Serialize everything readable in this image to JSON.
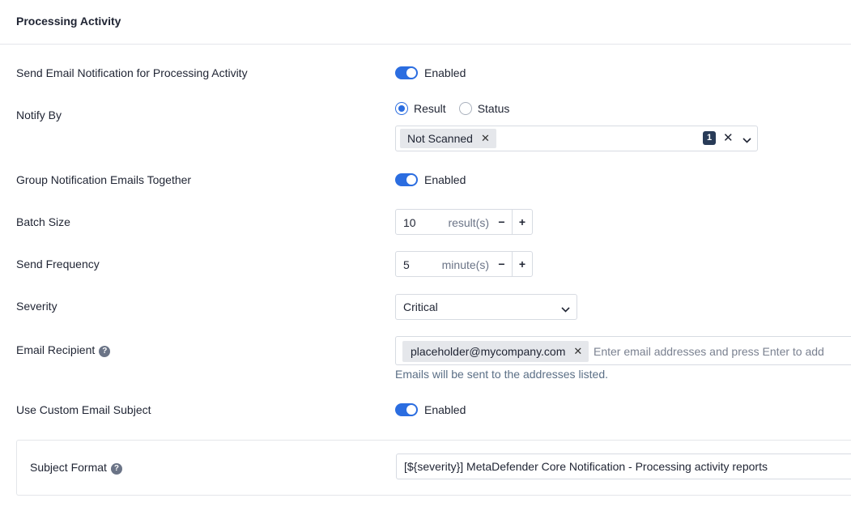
{
  "header": {
    "title": "Processing Activity"
  },
  "send_email": {
    "label": "Send Email Notification for Processing Activity",
    "toggle_label": "Enabled"
  },
  "notify_by": {
    "label": "Notify By",
    "options": [
      {
        "label": "Result",
        "checked": true
      },
      {
        "label": "Status",
        "checked": false
      }
    ],
    "selected_chips": [
      "Not Scanned"
    ],
    "count": "1"
  },
  "group_emails": {
    "label": "Group Notification Emails Together",
    "toggle_label": "Enabled"
  },
  "batch_size": {
    "label": "Batch Size",
    "value": "10",
    "unit": "result(s)",
    "minus": "−",
    "plus": "+"
  },
  "send_frequency": {
    "label": "Send Frequency",
    "value": "5",
    "unit": "minute(s)",
    "minus": "−",
    "plus": "+"
  },
  "severity": {
    "label": "Severity",
    "value": "Critical"
  },
  "email_recipient": {
    "label": "Email Recipient",
    "chips": [
      "placeholder@mycompany.com"
    ],
    "placeholder": "Enter email addresses and press Enter to add",
    "helper": "Emails will be sent to the addresses listed."
  },
  "custom_subject": {
    "label": "Use Custom Email Subject",
    "toggle_label": "Enabled"
  },
  "subject_format": {
    "label": "Subject Format",
    "value": "[${severity}] MetaDefender Core Notification - Processing activity reports"
  },
  "icons": {
    "help": "question-circle-icon",
    "remove": "close-icon",
    "dropdown": "chevron-down-icon"
  },
  "colors": {
    "accent": "#2b6de0",
    "badge": "#283b57",
    "helper_text": "#5b6f86"
  }
}
